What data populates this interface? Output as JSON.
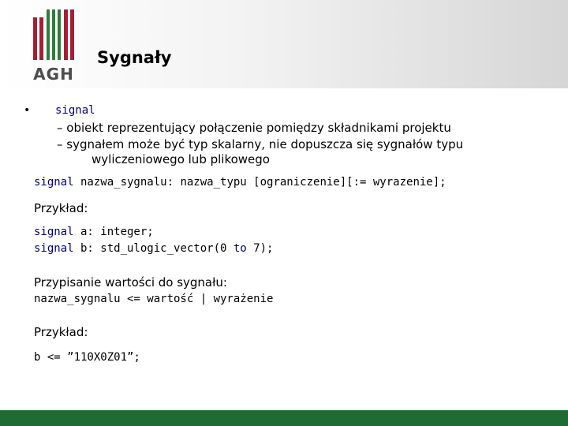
{
  "logo": {
    "text": "AGH"
  },
  "title": "Sygnały",
  "bullet": {
    "symbol": "•",
    "label": "signal",
    "items": [
      "– obiekt reprezentujący połączenie pomiędzy składnikami projektu",
      "– sygnałem może być typ skalarny, nie dopuszcza się sygnałów typu",
      "wyliczeniowego lub plikowego"
    ]
  },
  "syntax": {
    "keyword": "signal",
    "rest": " nazwa_sygnalu: nazwa_typu [ograniczenie][:= wyrazenie];"
  },
  "example1": {
    "heading": "Przykład:",
    "lines": [
      {
        "keyword": "signal",
        "rest": " a: integer;"
      },
      {
        "keyword": "signal",
        "rest": " b: std_ulogic_vector(0 ",
        "keyword2": "to",
        "rest2": " 7);"
      }
    ]
  },
  "assignment": {
    "heading": "Przypisanie wartości do sygnału:",
    "syntax": "nazwa_sygnalu <= wartość | wyrażenie"
  },
  "example2": {
    "heading": "Przykład:",
    "code": "b <= ”110X0Z01”;"
  },
  "colors": {
    "keyword": "#000080",
    "footer": "#1e6b33",
    "logo_red": "#a41e35",
    "logo_green": "#2f7d3a"
  }
}
